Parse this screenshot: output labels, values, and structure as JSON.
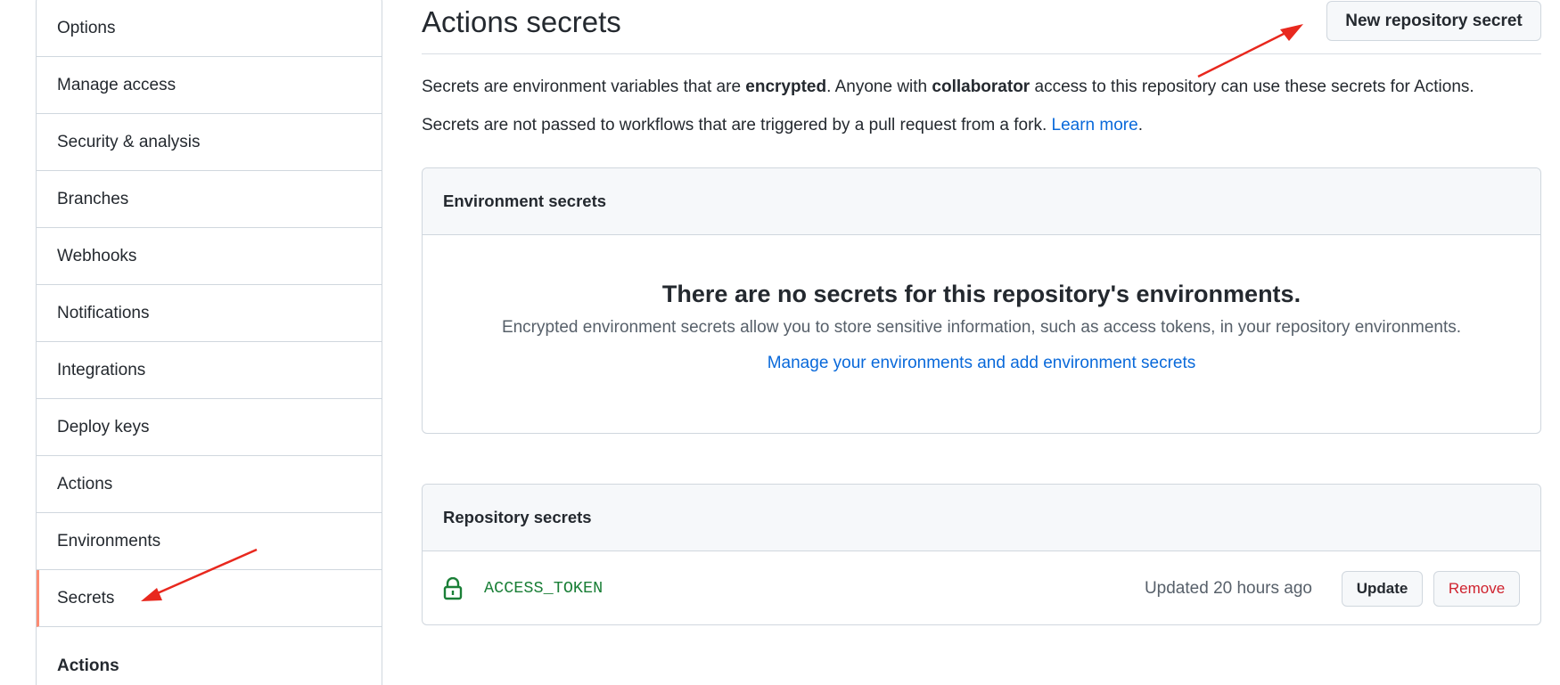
{
  "sidebar": {
    "items": [
      {
        "label": "Options"
      },
      {
        "label": "Manage access"
      },
      {
        "label": "Security & analysis"
      },
      {
        "label": "Branches"
      },
      {
        "label": "Webhooks"
      },
      {
        "label": "Notifications"
      },
      {
        "label": "Integrations"
      },
      {
        "label": "Deploy keys"
      },
      {
        "label": "Actions"
      },
      {
        "label": "Environments"
      },
      {
        "label": "Secrets",
        "selected": true
      }
    ],
    "group_title": "Actions"
  },
  "main": {
    "title": "Actions secrets",
    "new_secret_button": "New repository secret",
    "intro": {
      "p1_a": "Secrets are environment variables that are ",
      "p1_b": "encrypted",
      "p1_c": ". Anyone with ",
      "p1_d": "collaborator",
      "p1_e": " access to this repository can use these secrets for Actions.",
      "p2_a": "Secrets are not passed to workflows that are triggered by a pull request from a fork. ",
      "p2_link": "Learn more",
      "p2_end": "."
    },
    "environment_secrets": {
      "heading": "Environment secrets",
      "blank_title": "There are no secrets for this repository's environments.",
      "blank_desc": "Encrypted environment secrets allow you to store sensitive information, such as access tokens, in your repository environments.",
      "blank_link": "Manage your environments and add environment secrets"
    },
    "repository_secrets": {
      "heading": "Repository secrets",
      "rows": [
        {
          "name": "ACCESS_TOKEN",
          "updated": "Updated 20 hours ago",
          "update_label": "Update",
          "remove_label": "Remove"
        }
      ]
    }
  },
  "colors": {
    "accent_link": "#0969da",
    "selected_border": "#fd8c73",
    "secret_name": "#1a7f37",
    "danger": "#cf222e",
    "annotation_arrow": "#e8281e"
  }
}
